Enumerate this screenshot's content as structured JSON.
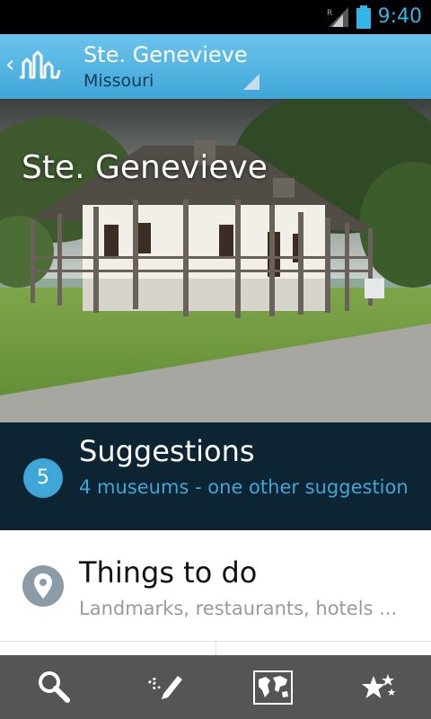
{
  "status_bar": {
    "time": "9:40",
    "roaming": "R"
  },
  "action_bar": {
    "title": "Ste. Genevieve",
    "subtitle": "Missouri"
  },
  "hero": {
    "title": "Ste. Genevieve"
  },
  "suggestions": {
    "count": "5",
    "title": "Suggestions",
    "subtitle": "4 museums - one other suggestion"
  },
  "things_to_do": {
    "title": "Things to do",
    "subtitle": "Landmarks, restaurants, hotels ..."
  },
  "bottom_nav": [
    "search-icon",
    "notes-pencil-icon",
    "world-map-icon",
    "favorites-stars-icon"
  ],
  "colors": {
    "accent": "#33b5e5",
    "action_bar": "#3fa6d8",
    "suggestions_bg": "#0d2433",
    "nav_bg": "#555555"
  }
}
